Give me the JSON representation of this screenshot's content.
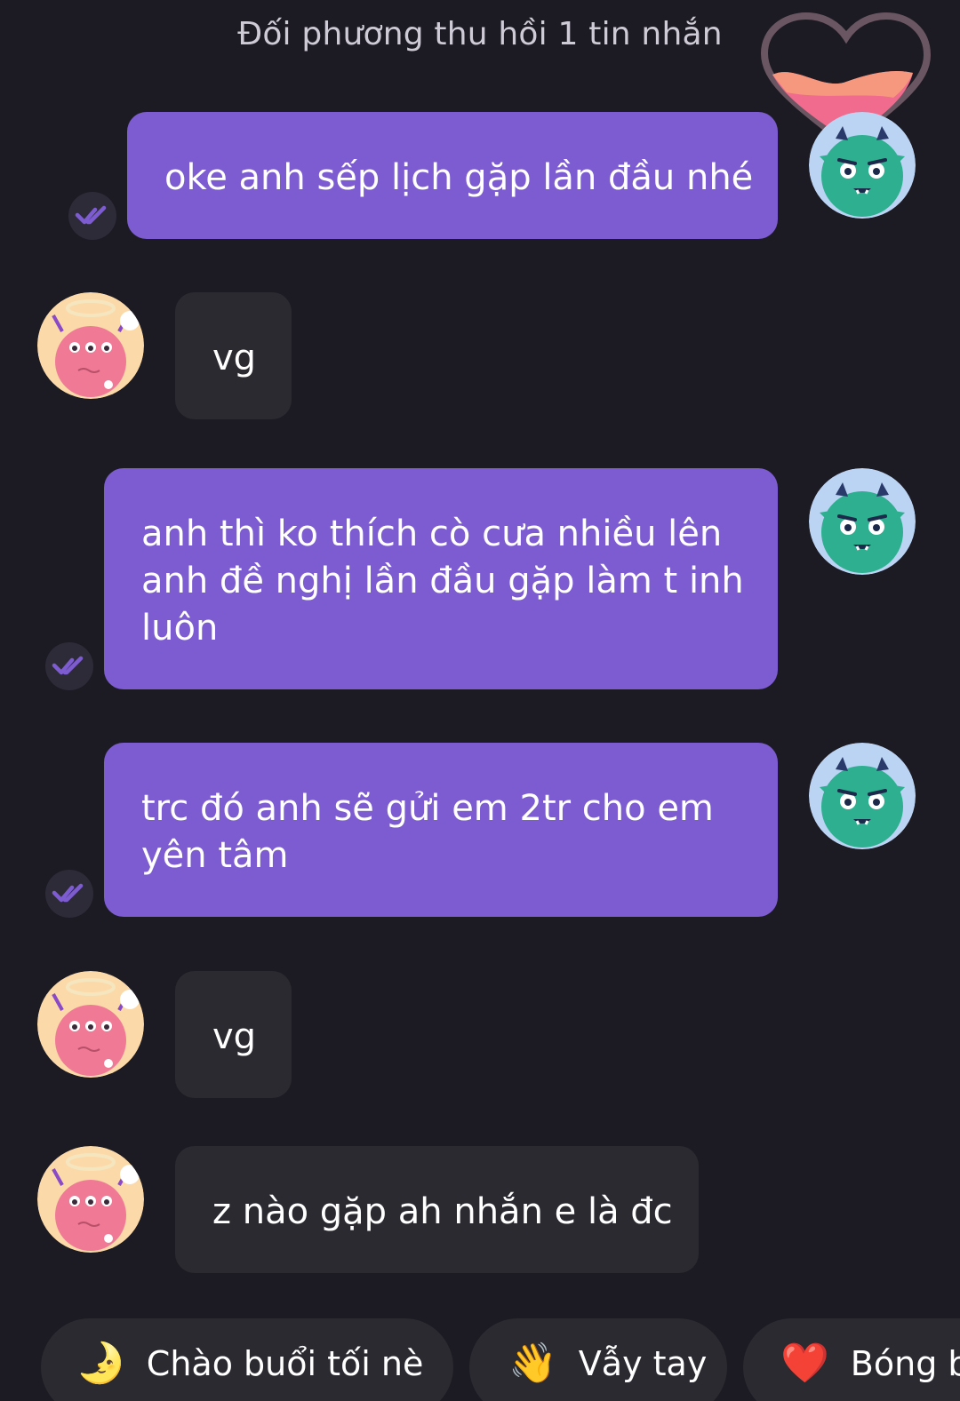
{
  "notice": "Đối phương thu hồi 1 tin nhắn",
  "messages": [
    {
      "lines": [
        "oke anh sếp lịch gặp lần đầu nhé"
      ]
    },
    {
      "lines": [
        "vg"
      ]
    },
    {
      "lines": [
        "anh thì ko thích cò cưa nhiều lên",
        "anh đề nghị lần đầu gặp làm t inh",
        "luôn"
      ]
    },
    {
      "lines": [
        "trc đó anh sẽ gửi em 2tr cho em",
        "yên tâm"
      ]
    },
    {
      "lines": [
        "vg"
      ]
    },
    {
      "lines": [
        "z nào gặp ah nhắn e là đc"
      ]
    }
  ],
  "quick_replies": [
    {
      "icon": "🌛",
      "label": "Chào buổi tối nè"
    },
    {
      "icon": "👋",
      "label": "Vẫy tay"
    },
    {
      "icon": "❤️",
      "label": "Bóng b"
    }
  ],
  "colors": {
    "background": "#1c1a22",
    "outgoing_bubble": "#7c5cd0",
    "incoming_bubble": "#2c2a31",
    "notice_text": "#cfcbd6"
  }
}
